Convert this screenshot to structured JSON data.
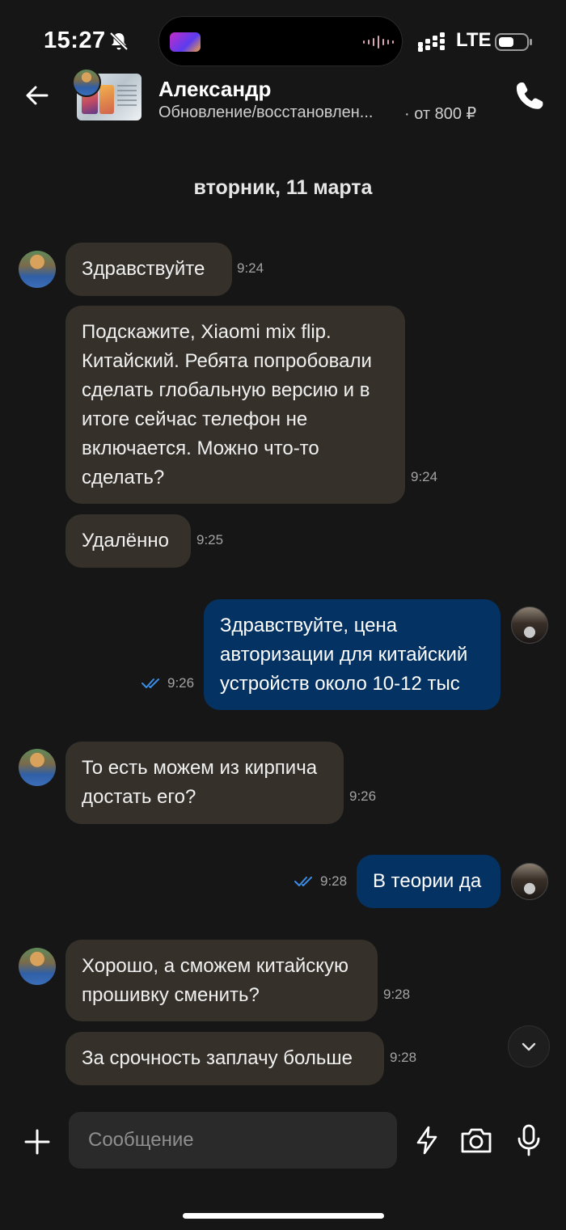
{
  "status_bar": {
    "time": "15:27",
    "network": "LTE"
  },
  "header": {
    "contact_name": "Александр",
    "listing_title": "Обновление/восстановлен...",
    "listing_price": "· от 800 ₽"
  },
  "date_separator": "вторник, 11 марта",
  "messages": [
    {
      "side": "in",
      "text": "Здравствуйте",
      "time": "9:24"
    },
    {
      "side": "in",
      "text": "Подскажите, Xiaomi mix flip. Китайский. Ребята попробовали сделать глобальную версию и в итоге сейчас телефон не включается. Можно что-то сделать?",
      "time": "9:24"
    },
    {
      "side": "in",
      "text": "Удалённо",
      "time": "9:25"
    },
    {
      "side": "out",
      "text": "Здравствуйте, цена авторизации для китайский устройств около 10-12 тыс",
      "time": "9:26",
      "status": "read"
    },
    {
      "side": "in",
      "text": "То есть можем из кирпича достать его?",
      "time": "9:26"
    },
    {
      "side": "out",
      "text": "В теории да",
      "time": "9:28",
      "status": "read"
    },
    {
      "side": "in",
      "text": "Хорошо, а сможем китайскую прошивку сменить?",
      "time": "9:28"
    },
    {
      "side": "in",
      "text": "За срочность заплачу больше",
      "time": "9:28"
    }
  ],
  "composer": {
    "placeholder": "Сообщение"
  },
  "colors": {
    "incoming_bubble": "#35312a",
    "outgoing_bubble": "#043363",
    "read_ticks": "#3a8ee6",
    "background": "#161616"
  }
}
